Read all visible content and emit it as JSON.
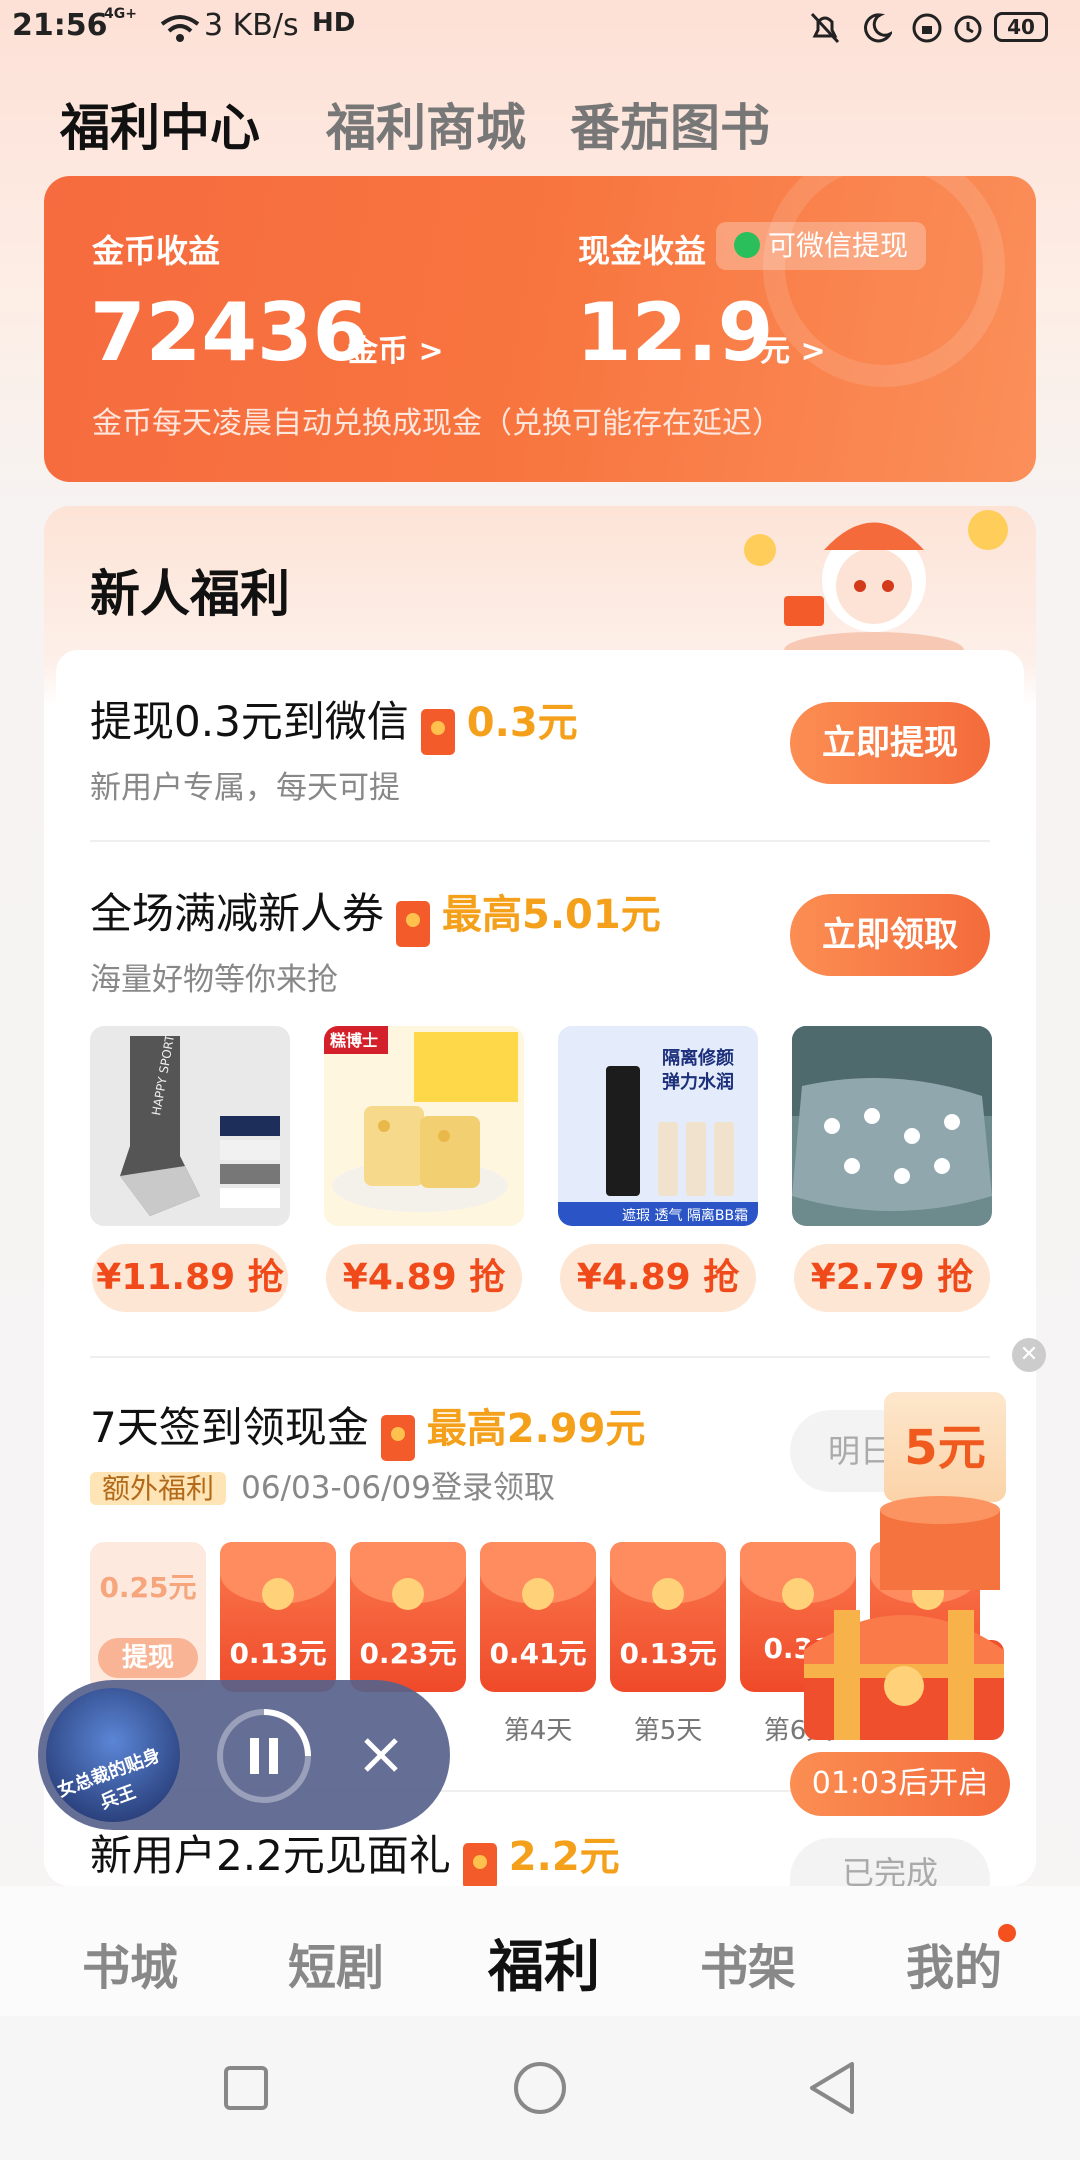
{
  "status_bar": {
    "time": "21:56",
    "network": "4G+",
    "speed": "3 KB/s",
    "hd": "HD",
    "battery": "40"
  },
  "tabs": [
    {
      "label": "福利中心"
    },
    {
      "label": "福利商城"
    },
    {
      "label": "番茄图书"
    }
  ],
  "earnings": {
    "coin_label": "金币收益",
    "coin_value": "72436",
    "coin_unit": "金币 >",
    "cash_label": "现金收益",
    "wechat_pill": "可微信提现",
    "cash_value": "12.9",
    "cash_unit": "元 >",
    "note": "金币每天凌晨自动兑换成现金（兑换可能存在延迟）"
  },
  "welfare": {
    "title": "新人福利",
    "item1": {
      "title": "提现0.3元到微信",
      "reward": "0.3元",
      "sub": "新用户专属，每天可提",
      "button": "立即提现"
    },
    "item2": {
      "title": "全场满减新人券",
      "reward": "最高5.01元",
      "sub": "海量好物等你来抢",
      "button": "立即领取"
    },
    "products": [
      {
        "price": "¥11.89 抢",
        "name": "socks"
      },
      {
        "price": "¥4.89 抢",
        "name": "snack"
      },
      {
        "price": "¥4.89 抢",
        "name": "bb-cream"
      },
      {
        "price": "¥2.79 抢",
        "name": "pillowcase"
      }
    ],
    "product_texts": {
      "snack_brand": "糕博士",
      "bb_title": "隔离修颜",
      "bb_sub": "弹力水润",
      "bb_bottom": "遮瑕 透气 隔离BB霜",
      "socks_text": "HAPPY SPORT"
    },
    "item3": {
      "title": "7天签到领现金",
      "reward": "最高2.99元",
      "extra_tag": "额外福利",
      "date_range": "06/03-06/09登录领取",
      "button": "明日"
    },
    "packets": [
      {
        "amount": "0.25元",
        "day": "提现"
      },
      {
        "amount": "0.13元",
        "day": ""
      },
      {
        "amount": "0.23元",
        "day": ""
      },
      {
        "amount": "0.41元",
        "day": "第4天"
      },
      {
        "amount": "0.13元",
        "day": "第5天"
      },
      {
        "amount": "0.38",
        "day": "第6天"
      }
    ],
    "item4": {
      "title": "新用户2.2元见面礼",
      "reward": "2.2元",
      "button": "已完成"
    }
  },
  "floating": {
    "bonus": "5元",
    "timer": "01:03后开启"
  },
  "player": {
    "title": "女总裁的贴身兵王"
  },
  "bottom_nav": [
    {
      "label": "书城"
    },
    {
      "label": "短剧"
    },
    {
      "label": "福利"
    },
    {
      "label": "书架"
    },
    {
      "label": "我的"
    }
  ],
  "colors": {
    "accent": "#f46b3b",
    "reward": "#f5a01a",
    "price": "#f04a1b"
  }
}
